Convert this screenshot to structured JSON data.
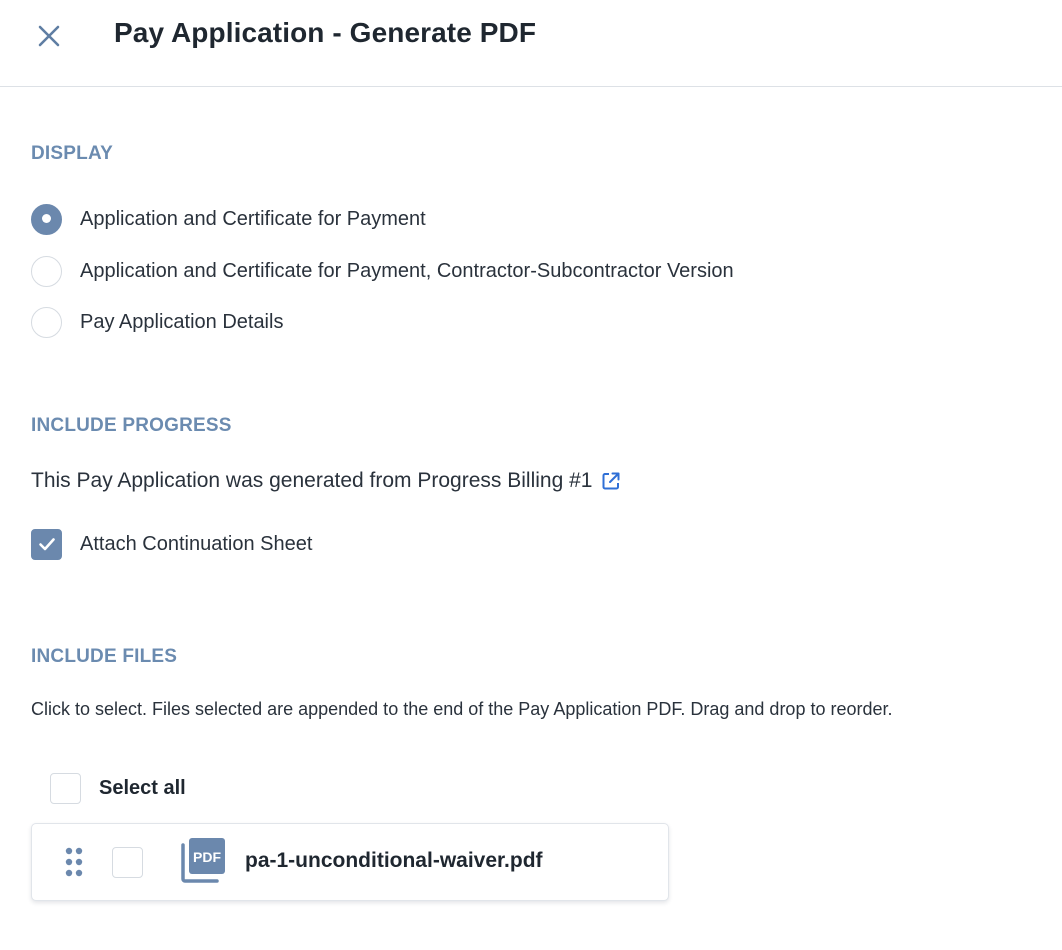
{
  "header": {
    "title": "Pay Application - Generate PDF",
    "close_icon": "close-icon"
  },
  "display": {
    "heading": "DISPLAY",
    "options": [
      {
        "label": "Application and Certificate for Payment",
        "checked": true
      },
      {
        "label": "Application and Certificate for Payment, Contractor-Subcontractor Version",
        "checked": false
      },
      {
        "label": "Pay Application Details",
        "checked": false
      }
    ]
  },
  "include_progress": {
    "heading": "INCLUDE PROGRESS",
    "info": "This Pay Application was generated from Progress Billing #1",
    "link_icon": "external-link-icon",
    "attach_label": "Attach Continuation Sheet",
    "attach_checked": true
  },
  "include_files": {
    "heading": "INCLUDE FILES",
    "help": "Click to select. Files selected are appended to the end of the Pay Application PDF. Drag and drop to reorder.",
    "select_all_label": "Select all",
    "files": [
      {
        "name": "pa-1-unconditional-waiver.pdf",
        "icon": "pdf-file-icon",
        "checked": false
      }
    ]
  },
  "colors": {
    "accent": "#6b88ad",
    "section_heading": "#6b8bb0",
    "link": "#2f6fd6"
  }
}
